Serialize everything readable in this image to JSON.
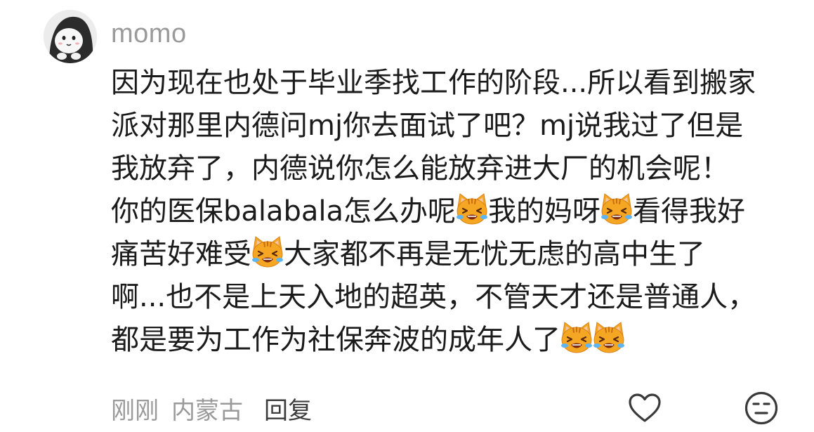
{
  "comment": {
    "username": "momo",
    "lines": [
      [
        {
          "t": "因为现在也处于毕业季找工作的阶段...所以看到搬家"
        }
      ],
      [
        {
          "t": "派对那里内德问mj你去面试了吧？mj说我过了但是"
        }
      ],
      [
        {
          "t": "我放弃了，内德说你怎么能放弃进大厂的机会呢！"
        }
      ],
      [
        {
          "t": "你的医保balabala怎么办呢"
        },
        {
          "e": "crying-cat-emoji"
        },
        {
          "t": "我的妈呀"
        },
        {
          "e": "crying-cat-emoji"
        },
        {
          "t": "看得我好"
        }
      ],
      [
        {
          "t": "痛苦好难受"
        },
        {
          "e": "crying-cat-emoji"
        },
        {
          "t": "大家都不再是无忧无虑的高中生了"
        }
      ],
      [
        {
          "t": "啊...也不是上天入地的超英，不管天才还是普通人，"
        }
      ],
      [
        {
          "t": "都是要为工作为社保奔波的成年人了"
        },
        {
          "e": "crying-cat-emoji"
        },
        {
          "e": "crying-cat-emoji"
        }
      ]
    ],
    "time": "刚刚",
    "location": "内蒙古",
    "reply_label": "回复"
  },
  "icons": {
    "like": "heart-outline-icon",
    "dislike": "unhappy-face-icon",
    "emoji": "crying-cat-emoji"
  },
  "colors": {
    "text": "#1b1b1b",
    "meta": "#9a9a9a",
    "reply": "#3c3c3c",
    "emoji_face": "#f5a623"
  }
}
